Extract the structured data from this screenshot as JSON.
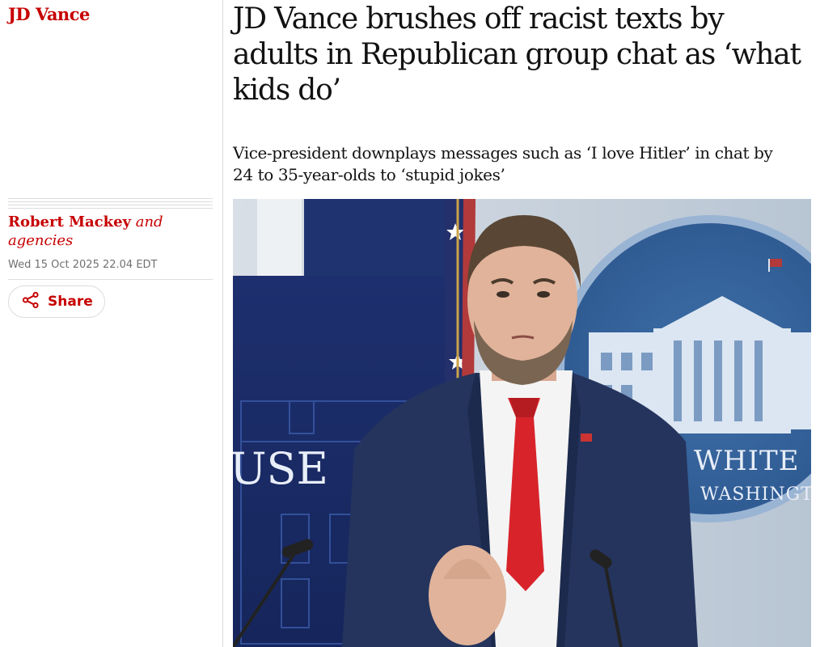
{
  "section": {
    "kicker": "JD Vance"
  },
  "article": {
    "headline": "JD Vance brushes off racist texts by adults in Republican group chat as ‘what kids do’",
    "standfirst": "Vice-president downplays messages such as ‘I love Hitler’ in chat by 24 to 35-year-olds to ‘stupid jokes’"
  },
  "byline": {
    "author": "Robert Mackey",
    "suffix": "and agencies"
  },
  "dateline": "Wed 15 Oct 2025 22.04 EDT",
  "share": {
    "label": "Share",
    "icon": "share-icon"
  },
  "photo": {
    "sign_left": "USE",
    "seal_line1": "WHITE",
    "seal_line2": "WASHINGT"
  },
  "colors": {
    "accent": "#c70000",
    "text": "#121212",
    "muted": "#707070",
    "rule": "#dcdcdc"
  }
}
